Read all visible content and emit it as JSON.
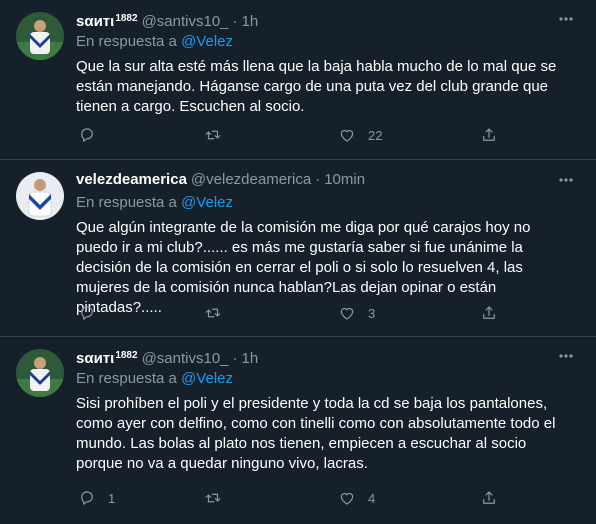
{
  "colors": {
    "background": "#15202b",
    "link": "#1d9bf0",
    "muted": "#8b98a5",
    "divider": "#38444d"
  },
  "tweets": [
    {
      "name": "ѕαитι",
      "name_sup": "1882",
      "handle": "@santivs10_",
      "time": "1h",
      "reply_prefix": "En respuesta a",
      "reply_to": "@Velez",
      "text": "Que la sur alta esté más llena que la baja habla mucho de lo mal que se están manejando. Háganse cargo de una puta vez del club grande que tienen a cargo. Escuchen al socio.",
      "replies": "",
      "retweets": "",
      "likes": "22"
    },
    {
      "name": "velezdeamerica",
      "name_sup": "",
      "handle": "@velezdeamerica",
      "time": "10min",
      "reply_prefix": "En respuesta a",
      "reply_to": "@Velez",
      "text": "Que algún integrante de la comisión me diga por qué carajos hoy no puedo ir a mi club?...... es más me gustaría saber si fue unánime la decisión de la comisión en cerrar el poli o si solo lo resuelven 4, las mujeres de la comisión nunca hablan?Las dejan opinar o están pintadas?.....",
      "replies": "",
      "retweets": "",
      "likes": "3"
    },
    {
      "name": "ѕαитι",
      "name_sup": "1882",
      "handle": "@santivs10_",
      "time": "1h",
      "reply_prefix": "En respuesta a",
      "reply_to": "@Velez",
      "text": "Sisi prohíben el poli y el presidente y toda la cd se baja los pantalones, como ayer con delfino, como con tinelli como con absolutamente todo el mundo. Las bolas al plato nos tienen, empiecen a escuchar al socio porque no va a quedar ninguno vivo, lacras.",
      "replies": "1",
      "retweets": "",
      "likes": "4"
    }
  ],
  "icons": {
    "reply": "reply-icon",
    "retweet": "retweet-icon",
    "like": "heart-icon",
    "share": "share-icon",
    "more": "more-icon"
  }
}
